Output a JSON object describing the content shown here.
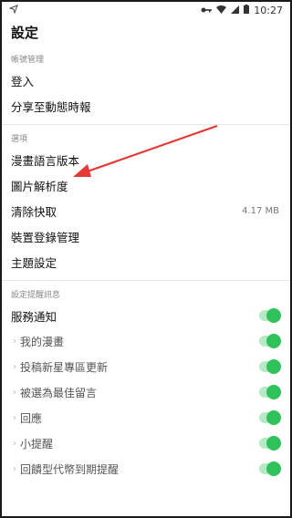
{
  "status_bar": {
    "time": "10:27",
    "icons": [
      "location-arrow-icon",
      "key-icon",
      "wifi-icon",
      "signal-icon",
      "battery-icon"
    ]
  },
  "app_bar": {
    "title": "設定"
  },
  "sections": [
    {
      "header": "帳號管理",
      "items": [
        {
          "label": "登入"
        },
        {
          "label": "分享至動態時報"
        }
      ]
    },
    {
      "header": "選項",
      "items": [
        {
          "label": "漫畫語言版本"
        },
        {
          "label": "圖片解析度"
        },
        {
          "label": "清除快取",
          "value": "4.17 MB"
        },
        {
          "label": "裝置登錄管理"
        },
        {
          "label": "主題設定"
        }
      ]
    },
    {
      "header": "設定提醒訊息",
      "items": [
        {
          "label": "服務通知",
          "toggle": true
        },
        {
          "label": "我的漫畫",
          "toggle": true,
          "sub": true
        },
        {
          "label": "投稿新星專區更新",
          "toggle": true,
          "sub": true
        },
        {
          "label": "被選為最佳留言",
          "toggle": true,
          "sub": true
        },
        {
          "label": "回應",
          "toggle": true,
          "sub": true
        },
        {
          "label": "小提醒",
          "toggle": true,
          "sub": true
        },
        {
          "label": "回饋型代幣到期提醒",
          "toggle": true,
          "sub": true
        }
      ]
    }
  ],
  "colors": {
    "toggle_on": "#2fc25b",
    "toggle_track": "#b7e8c7",
    "annotation_arrow": "#e53935"
  }
}
